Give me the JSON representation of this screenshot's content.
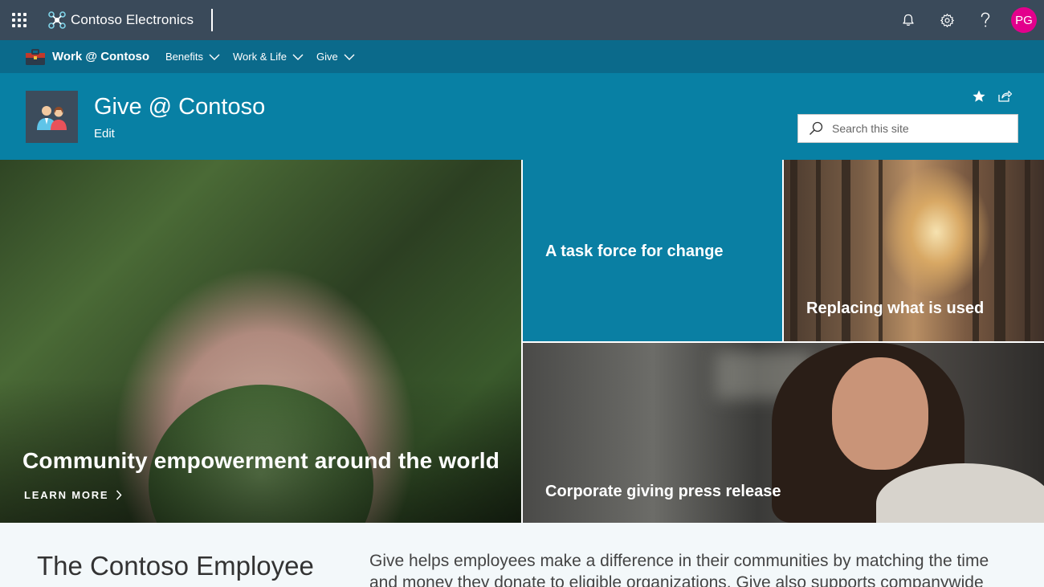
{
  "suite_bar": {
    "app_launcher_icon": "waffle-icon",
    "brand_name": "Contoso Electronics",
    "brand_icon": "network-logo-icon",
    "notifications_icon": "bell-icon",
    "settings_icon": "gear-icon",
    "help_icon": "question-icon",
    "avatar_initials": "PG",
    "avatar_color": "#e3008c"
  },
  "hub_nav": {
    "title": "Work @ Contoso",
    "items": [
      {
        "label": "Benefits"
      },
      {
        "label": "Work & Life"
      },
      {
        "label": "Give"
      }
    ]
  },
  "site_header": {
    "title": "Give @ Contoso",
    "edit_label": "Edit",
    "follow_icon": "star-icon",
    "share_icon": "share-icon",
    "search_placeholder": "Search this site",
    "background_color": "#0880a4"
  },
  "hero": {
    "main": {
      "title": "Community empowerment around the world",
      "link_label": "LEARN MORE"
    },
    "tiles": [
      {
        "title": "A task force for change"
      },
      {
        "title": "Replacing what is used"
      },
      {
        "title": "Corporate giving press release"
      }
    ]
  },
  "content": {
    "heading": "The Contoso Employee",
    "body": "Give helps employees make a difference in their communities by matching the time and money they donate to eligible organizations. Give also supports companywide giving"
  }
}
